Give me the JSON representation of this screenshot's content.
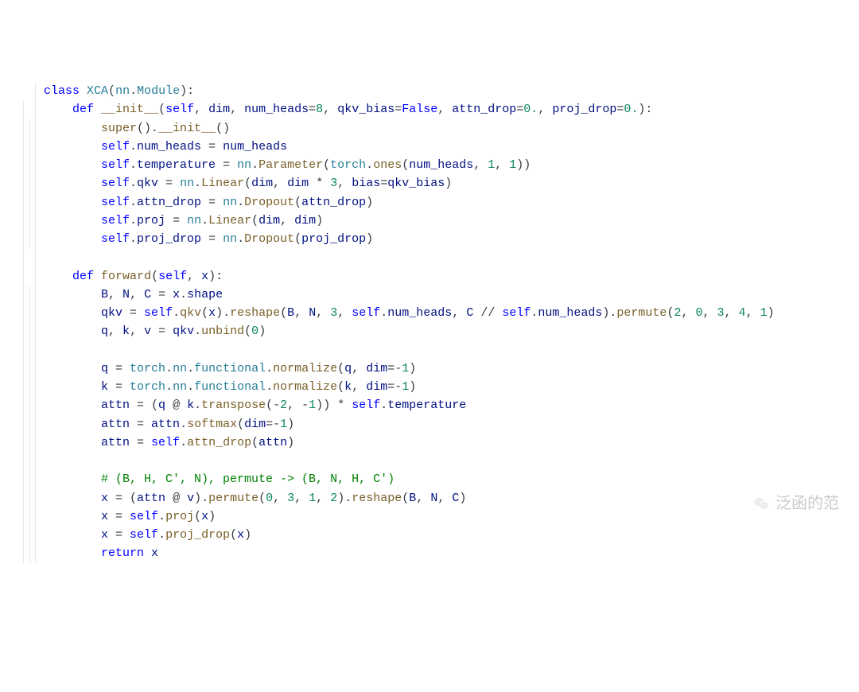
{
  "watermark": "泛函的范",
  "code": {
    "l1": {
      "indent": 0,
      "html": "<span class='kw'>class</span> <span class='cls'>XCA</span>(<span class='cls'>nn</span>.<span class='cls'>Module</span>):"
    },
    "l2": {
      "indent": 1,
      "html": "<span class='kw'>def</span> <span class='fn'>__init__</span>(<span class='self'>self</span>, <span class='param'>dim</span>, <span class='param'>num_heads</span>=<span class='num'>8</span>, <span class='param'>qkv_bias</span>=<span class='const'>False</span>, <span class='param'>attn_drop</span>=<span class='num'>0.</span>, <span class='param'>proj_drop</span>=<span class='num'>0.</span>):"
    },
    "l3": {
      "indent": 2,
      "html": "<span class='fn'>super</span>().<span class='fn'>__init__</span>()"
    },
    "l4": {
      "indent": 2,
      "html": "<span class='self'>self</span>.<span class='attr'>num_heads</span> = <span class='id'>num_heads</span>"
    },
    "l5": {
      "indent": 2,
      "html": "<span class='self'>self</span>.<span class='attr'>temperature</span> = <span class='cls'>nn</span>.<span class='fn'>Parameter</span>(<span class='cls'>torch</span>.<span class='fn'>ones</span>(<span class='id'>num_heads</span>, <span class='num'>1</span>, <span class='num'>1</span>))"
    },
    "l6": {
      "indent": 2,
      "html": "<span class='self'>self</span>.<span class='attr'>qkv</span> = <span class='cls'>nn</span>.<span class='fn'>Linear</span>(<span class='id'>dim</span>, <span class='id'>dim</span> * <span class='num'>3</span>, <span class='param'>bias</span>=<span class='id'>qkv_bias</span>)"
    },
    "l7": {
      "indent": 2,
      "html": "<span class='self'>self</span>.<span class='attr'>attn_drop</span> = <span class='cls'>nn</span>.<span class='fn'>Dropout</span>(<span class='id'>attn_drop</span>)"
    },
    "l8": {
      "indent": 2,
      "html": "<span class='self'>self</span>.<span class='attr'>proj</span> = <span class='cls'>nn</span>.<span class='fn'>Linear</span>(<span class='id'>dim</span>, <span class='id'>dim</span>)"
    },
    "l9": {
      "indent": 2,
      "html": "<span class='self'>self</span>.<span class='attr'>proj_drop</span> = <span class='cls'>nn</span>.<span class='fn'>Dropout</span>(<span class='id'>proj_drop</span>)"
    },
    "l10": {
      "indent": 1,
      "html": ""
    },
    "l11": {
      "indent": 1,
      "html": "<span class='kw'>def</span> <span class='fn'>forward</span>(<span class='self'>self</span>, <span class='param'>x</span>):"
    },
    "l12": {
      "indent": 2,
      "html": "<span class='id'>B</span>, <span class='id'>N</span>, <span class='id'>C</span> = <span class='id'>x</span>.<span class='attr'>shape</span>"
    },
    "l13": {
      "indent": 2,
      "html": "<span class='id'>qkv</span> = <span class='self'>self</span>.<span class='fn'>qkv</span>(<span class='id'>x</span>).<span class='fn'>reshape</span>(<span class='id'>B</span>, <span class='id'>N</span>, <span class='num'>3</span>, <span class='self'>self</span>.<span class='attr'>num_heads</span>, <span class='id'>C</span> // <span class='self'>self</span>.<span class='attr'>num_heads</span>).<span class='fn'>permute</span>(<span class='num'>2</span>, <span class='num'>0</span>, <span class='num'>3</span>, <span class='num'>4</span>, <span class='num'>1</span>)"
    },
    "l14": {
      "indent": 2,
      "html": "<span class='id'>q</span>, <span class='id'>k</span>, <span class='id'>v</span> = <span class='id'>qkv</span>.<span class='fn'>unbind</span>(<span class='num'>0</span>)"
    },
    "l15": {
      "indent": 2,
      "html": ""
    },
    "l16": {
      "indent": 2,
      "html": "<span class='id'>q</span> = <span class='cls'>torch</span>.<span class='cls'>nn</span>.<span class='cls'>functional</span>.<span class='fn'>normalize</span>(<span class='id'>q</span>, <span class='param'>dim</span>=-<span class='num'>1</span>)"
    },
    "l17": {
      "indent": 2,
      "html": "<span class='id'>k</span> = <span class='cls'>torch</span>.<span class='cls'>nn</span>.<span class='cls'>functional</span>.<span class='fn'>normalize</span>(<span class='id'>k</span>, <span class='param'>dim</span>=-<span class='num'>1</span>)"
    },
    "l18": {
      "indent": 2,
      "html": "<span class='id'>attn</span> = (<span class='id'>q</span> @ <span class='id'>k</span>.<span class='fn'>transpose</span>(-<span class='num'>2</span>, -<span class='num'>1</span>)) * <span class='self'>self</span>.<span class='attr'>temperature</span>"
    },
    "l19": {
      "indent": 2,
      "html": "<span class='id'>attn</span> = <span class='id'>attn</span>.<span class='fn'>softmax</span>(<span class='param'>dim</span>=-<span class='num'>1</span>)"
    },
    "l20": {
      "indent": 2,
      "html": "<span class='id'>attn</span> = <span class='self'>self</span>.<span class='fn'>attn_drop</span>(<span class='id'>attn</span>)"
    },
    "l21": {
      "indent": 2,
      "html": ""
    },
    "l22": {
      "indent": 2,
      "html": "<span class='cmt'># (B, H, C', N), permute -> (B, N, H, C')</span>"
    },
    "l23": {
      "indent": 2,
      "html": "<span class='id'>x</span> = (<span class='id'>attn</span> @ <span class='id'>v</span>).<span class='fn'>permute</span>(<span class='num'>0</span>, <span class='num'>3</span>, <span class='num'>1</span>, <span class='num'>2</span>).<span class='fn'>reshape</span>(<span class='id'>B</span>, <span class='id'>N</span>, <span class='id'>C</span>)"
    },
    "l24": {
      "indent": 2,
      "html": "<span class='id'>x</span> = <span class='self'>self</span>.<span class='fn'>proj</span>(<span class='id'>x</span>)"
    },
    "l25": {
      "indent": 2,
      "html": "<span class='id'>x</span> = <span class='self'>self</span>.<span class='fn'>proj_drop</span>(<span class='id'>x</span>)"
    },
    "l26": {
      "indent": 2,
      "html": "<span class='kw'>return</span> <span class='id'>x</span>"
    }
  },
  "lines_order": [
    "l1",
    "l2",
    "l3",
    "l4",
    "l5",
    "l6",
    "l7",
    "l8",
    "l9",
    "l10",
    "l11",
    "l12",
    "l13",
    "l14",
    "l15",
    "l16",
    "l17",
    "l18",
    "l19",
    "l20",
    "l21",
    "l22",
    "l23",
    "l24",
    "l25",
    "l26"
  ]
}
